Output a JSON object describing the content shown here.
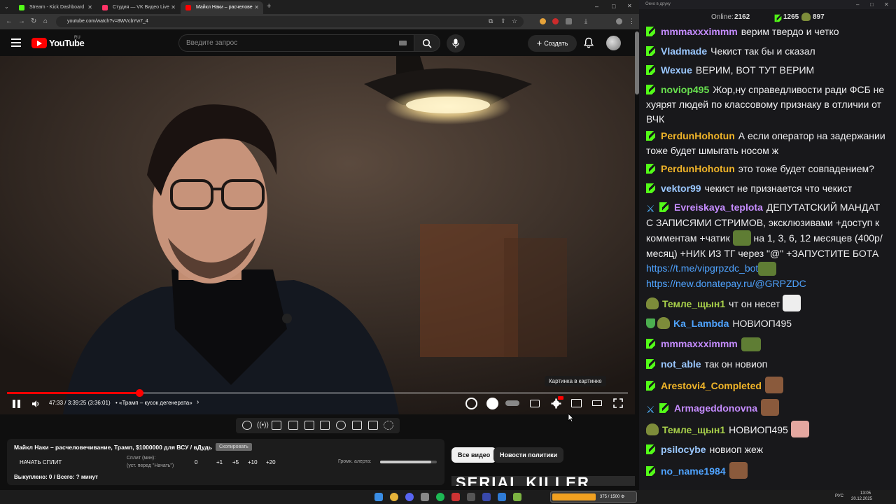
{
  "browser": {
    "tabs": [
      {
        "title": "Stream - Kick Dashboard",
        "color": "#53fc18"
      },
      {
        "title": "Студия — VK Видео Live",
        "color": "#ff3366"
      },
      {
        "title": "Майкл Наки – расчелове",
        "color": "#ff0000"
      }
    ],
    "new_tab": "+",
    "url": "youtube.com/watch?v=8WVcbYw7_4",
    "win_minimize": "–",
    "win_maximize": "□",
    "win_close": "✕"
  },
  "youtube": {
    "logo_text": "YouTube",
    "logo_region": "RU",
    "search_placeholder": "Введите запрос",
    "create_label": "Создать",
    "video": {
      "time": "47:33 / 3:39:25 (3:36:01)",
      "chapter": "• «Трамп – кусок дегенерата»",
      "progress": 0.2136,
      "pip_tooltip": "Картинка в картинке"
    },
    "chips": [
      "Все видео",
      "Новости политики"
    ],
    "thumb_text": "SERIAL KILLER"
  },
  "split_panel": {
    "title": "Майкл Наки – расчеловечивание, Трамп, $1000000 для ВСУ / вДудь",
    "copy_label": "Скопировать",
    "start_label": "НАЧАТЬ СПЛИТ",
    "split_label": "Сплит (мин):",
    "split_hint": "(уст. перед \"Начать\")",
    "split_value": "0",
    "increments": [
      "+1",
      "+5",
      "+10",
      "+20"
    ],
    "volume_label": "Громк. алерта:",
    "volume": 0.9,
    "summary": "Выкуплено: 0 / Всего: ? минут"
  },
  "chat": {
    "window_title": "Окно в друку",
    "online_label": "Online:",
    "online_count": "2162",
    "followers": "1265",
    "subs": "897",
    "messages": [
      {
        "user": "mmmaxxximmm",
        "color": "#c58cff",
        "text": "верим твердо и четко"
      },
      {
        "user": "Vladmade",
        "color": "#9bc8ff",
        "text": "Чекист так бы и сказал"
      },
      {
        "user": "Wexue",
        "color": "#9bc8ff",
        "text": "ВЕРИМ, ВОТ ТУТ ВЕРИМ"
      },
      {
        "user": "noviop495",
        "color": "#68e04f",
        "text": "Жор,ну справедливости ради ФСБ не хуярят людей по классовому признаку в отличии от ВЧК"
      },
      {
        "user": "PerdunHohotun",
        "color": "#f0b429",
        "text": "А если оператор на задержании тоже будет шмыгать носом ж"
      },
      {
        "user": "PerdunHohotun",
        "color": "#f0b429",
        "text": "это тоже будет совпадением?"
      },
      {
        "user": "vektor99",
        "color": "#9bc8ff",
        "text": "чекист не признается что чекист"
      },
      {
        "user": "Evreiskaya_teplota",
        "color": "#c58cff",
        "text": "ДЕПУТАТСКИЙ МАНДАТ С ЗАПИСЯМИ СТРИМОВ, эксклюзивами +доступ к комментам +чатик",
        "text2": "на 1, 3, 6, 12 месяцев (400р/месяц) +НИК ИЗ ТГ через \"@\" +ЗАПУСТИТЕ БОТА",
        "link1": "https://t.me/vipgrpzdc_bot",
        "link2": "https://new.donatepay.ru/@GRPZDC"
      },
      {
        "user": "Темле_щын1",
        "color": "#a8d04a",
        "text": "чт он несет"
      },
      {
        "user": "Ka_Lambda",
        "color": "#4fa3ff",
        "text": "НОВИОП495"
      },
      {
        "user": "mmmaxxximmm",
        "color": "#c58cff",
        "text": ""
      },
      {
        "user": "not_able",
        "color": "#9bc8ff",
        "text": "так он новиоп"
      },
      {
        "user": "Arestovi4_Completed",
        "color": "#f0b429",
        "text": ""
      },
      {
        "user": "Armageddonovna",
        "color": "#c58cff",
        "text": ""
      },
      {
        "user": "Темле_щын1",
        "color": "#a8d04a",
        "text": "НОВИОП495"
      },
      {
        "user": "psilocybe",
        "color": "#9bc8ff",
        "text": "новиоп жеж"
      },
      {
        "user": "no_name1984",
        "color": "#4fa3ff",
        "text": ""
      }
    ]
  },
  "taskbar": {
    "lang": "РУС",
    "time": "13:05",
    "date": "20.12.2025",
    "stream_widget": "375 / 1500 ⚙"
  }
}
